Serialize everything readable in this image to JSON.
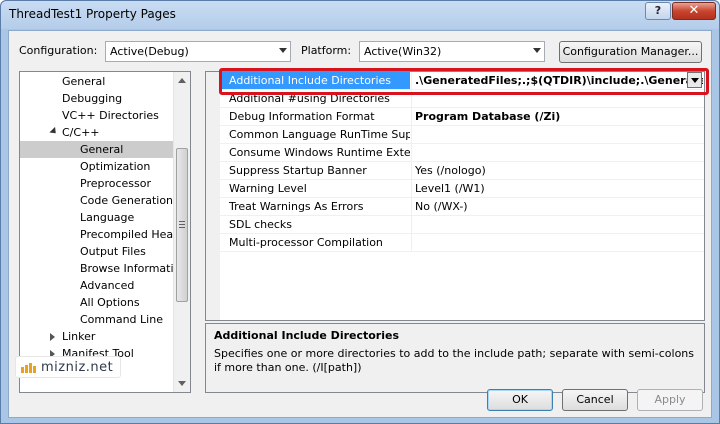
{
  "window": {
    "title": "ThreadTest1 Property Pages",
    "help_label": "?",
    "close_label": "✕"
  },
  "toolbar": {
    "configuration_label": "Configuration:",
    "configuration_value": "Active(Debug)",
    "platform_label": "Platform:",
    "platform_value": "Active(Win32)",
    "config_manager_label": "Configuration Manager..."
  },
  "tree": {
    "items": [
      {
        "label": "General"
      },
      {
        "label": "Debugging"
      },
      {
        "label": "VC++ Directories"
      },
      {
        "label": "C/C++"
      },
      {
        "label": "General"
      },
      {
        "label": "Optimization"
      },
      {
        "label": "Preprocessor"
      },
      {
        "label": "Code Generation"
      },
      {
        "label": "Language"
      },
      {
        "label": "Precompiled Heade"
      },
      {
        "label": "Output Files"
      },
      {
        "label": "Browse Information"
      },
      {
        "label": "Advanced"
      },
      {
        "label": "All Options"
      },
      {
        "label": "Command Line"
      },
      {
        "label": "Linker"
      },
      {
        "label": "Manifest Tool"
      }
    ]
  },
  "properties": {
    "rows": [
      {
        "name": "Additional Include Directories",
        "value": ".\\GeneratedFiles;.;$(QTDIR)\\include;.\\GeneratedFile"
      },
      {
        "name": "Additional #using Directories",
        "value": ""
      },
      {
        "name": "Debug Information Format",
        "value": "Program Database (/Zi)"
      },
      {
        "name": "Common Language RunTime Suppo",
        "value": ""
      },
      {
        "name": "Consume Windows Runtime Extensic",
        "value": ""
      },
      {
        "name": "Suppress Startup Banner",
        "value": "Yes (/nologo)"
      },
      {
        "name": "Warning Level",
        "value": "Level1 (/W1)"
      },
      {
        "name": "Treat Warnings As Errors",
        "value": "No (/WX-)"
      },
      {
        "name": "SDL checks",
        "value": ""
      },
      {
        "name": "Multi-processor Compilation",
        "value": ""
      }
    ]
  },
  "description": {
    "title": "Additional Include Directories",
    "text": "Specifies one or more directories to add to the include path; separate with semi-colons if more than one.     (/I[path])"
  },
  "footer": {
    "logo_text": "mizniz.net",
    "ok_label": "OK",
    "cancel_label": "Cancel",
    "apply_label": "Apply"
  },
  "colors": {
    "selection": "#3399ff",
    "highlight_box": "#d9131d",
    "tree_selection": "#cccccc"
  }
}
